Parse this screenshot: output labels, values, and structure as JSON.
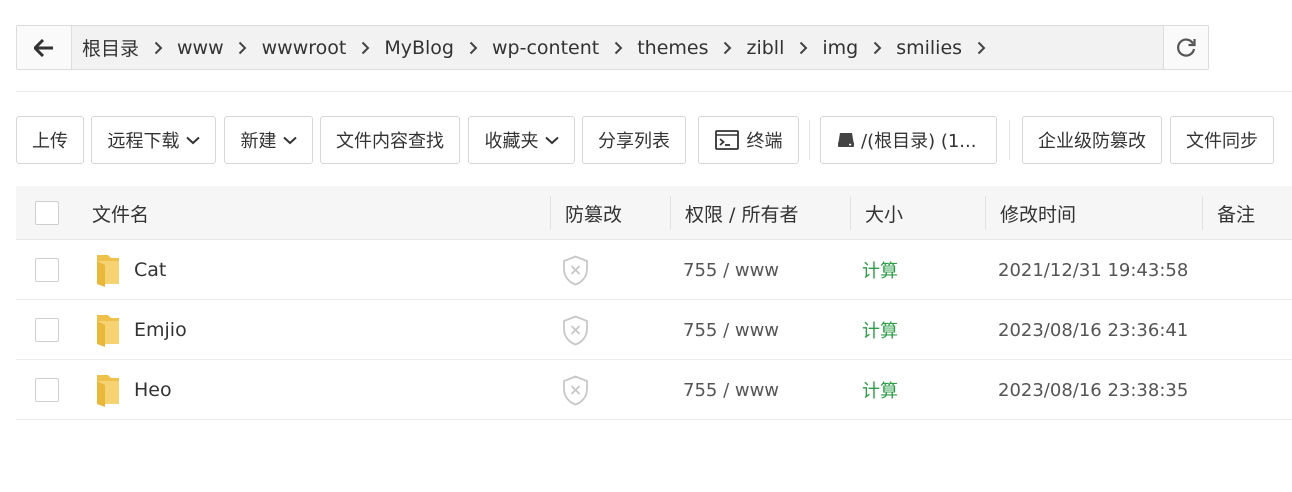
{
  "breadcrumb": {
    "items": [
      "根目录",
      "www",
      "wwwroot",
      "MyBlog",
      "wp-content",
      "themes",
      "zibll",
      "img",
      "smilies"
    ]
  },
  "toolbar": {
    "upload": "上传",
    "remote_download": "远程下载",
    "new": "新建",
    "content_search": "文件内容查找",
    "favorites": "收藏夹",
    "share_list": "分享列表",
    "terminal": "终端",
    "disk": "/(根目录) (1...",
    "tamper_proof": "企业级防篡改",
    "file_sync": "文件同步"
  },
  "table": {
    "headers": {
      "name": "文件名",
      "tamper": "防篡改",
      "perm": "权限 / 所有者",
      "size": "大小",
      "mtime": "修改时间",
      "note": "备注"
    },
    "rows": [
      {
        "name": "Cat",
        "perm": "755 / www",
        "size": "计算",
        "mtime": "2021/12/31 19:43:58"
      },
      {
        "name": "Emjio",
        "perm": "755 / www",
        "size": "计算",
        "mtime": "2023/08/16 23:36:41"
      },
      {
        "name": "Heo",
        "perm": "755 / www",
        "size": "计算",
        "mtime": "2023/08/16 23:38:35"
      }
    ]
  },
  "colors": {
    "folder": "#f5c94f",
    "calc_link": "#2e9e4a",
    "header_bg": "#f6f6f6"
  }
}
